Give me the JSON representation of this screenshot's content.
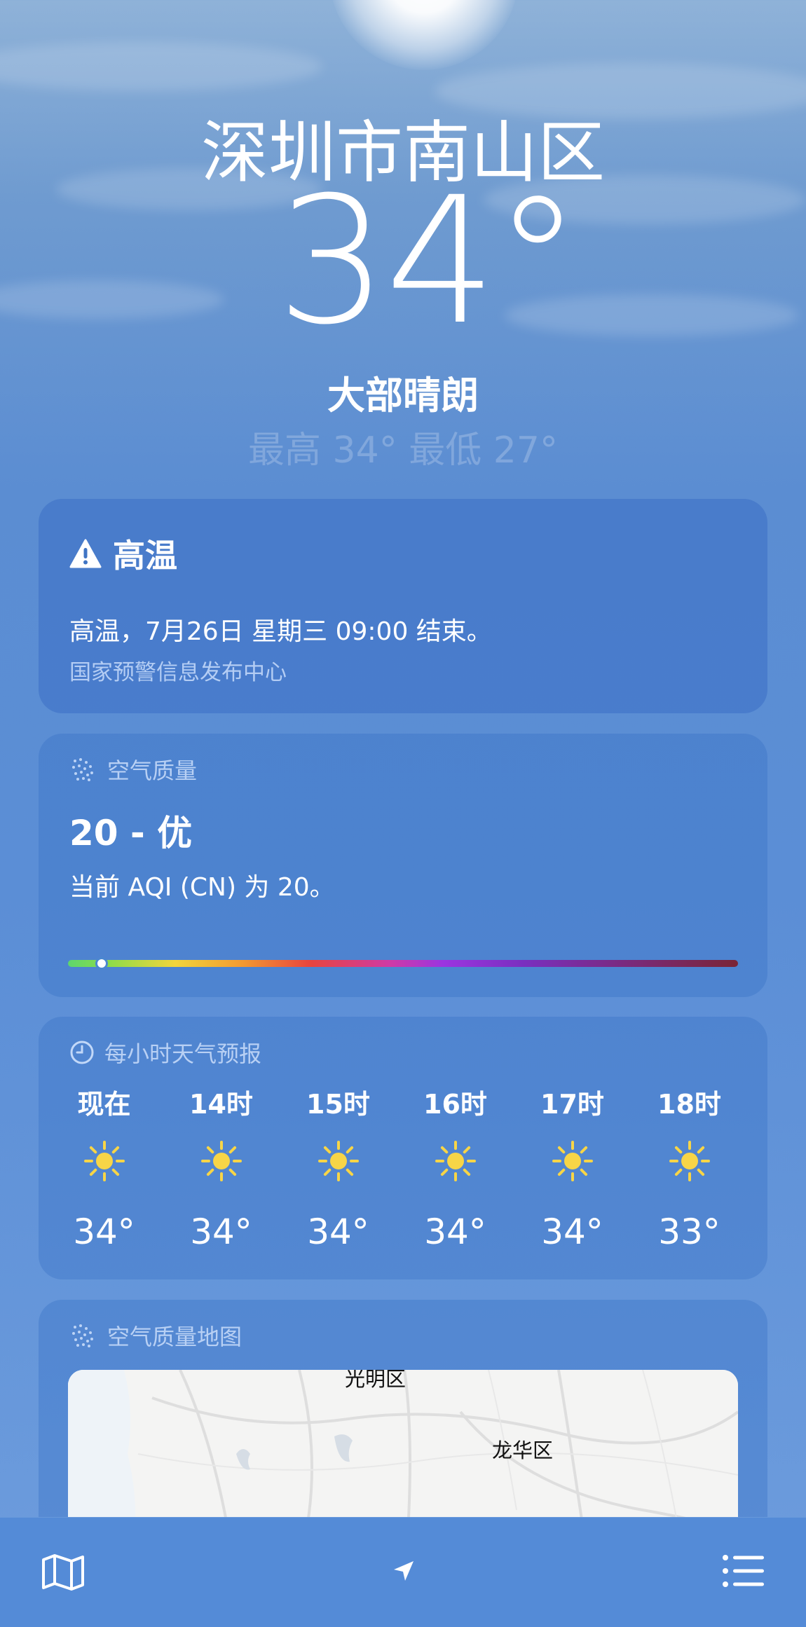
{
  "header": {
    "city": "深圳市南山区",
    "temperature": "34°",
    "condition": "大部晴朗",
    "high_low": "最高 34°  最低 27°"
  },
  "alert": {
    "icon": "warning-icon",
    "title": "高温",
    "body": "高温，7月26日 星期三 09:00 结束。",
    "source": "国家预警信息发布中心"
  },
  "air_quality": {
    "icon": "air-quality-dots-icon",
    "title": "空气质量",
    "value": "20 - 优",
    "description": "当前 AQI (CN) 为 20。",
    "level_fraction": 0.05
  },
  "hourly": {
    "icon": "clock-icon",
    "title": "每小时天气预报",
    "items": [
      {
        "label": "现在",
        "icon": "sun-icon",
        "temp": "34°"
      },
      {
        "label": "14时",
        "icon": "sun-icon",
        "temp": "34°"
      },
      {
        "label": "15时",
        "icon": "sun-icon",
        "temp": "34°"
      },
      {
        "label": "16时",
        "icon": "sun-icon",
        "temp": "34°"
      },
      {
        "label": "17时",
        "icon": "sun-icon",
        "temp": "34°"
      },
      {
        "label": "18时",
        "icon": "sun-icon",
        "temp": "33°"
      }
    ]
  },
  "aqi_map": {
    "icon": "air-quality-dots-icon",
    "title": "空气质量地图",
    "labels": [
      "光明区",
      "龙华区"
    ]
  },
  "tabbar": {
    "left_icon": "map-icon",
    "center_icon": "location-arrow-icon",
    "right_icon": "list-icon"
  },
  "colors": {
    "aqi_good": "#5ed66d",
    "sun": "#f7d547",
    "card_bg": "#3b70c4",
    "tabbar_bg": "#548bd7"
  }
}
